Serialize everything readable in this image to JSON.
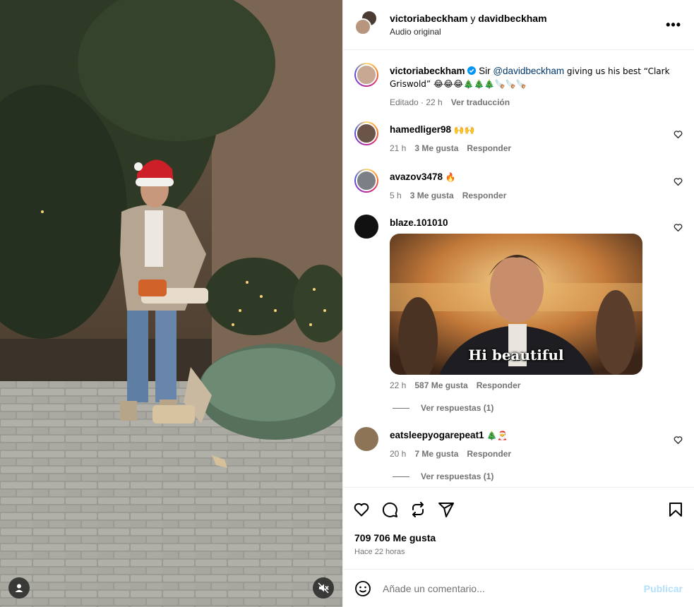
{
  "header": {
    "user1": "victoriabeckham",
    "conjunction": "y",
    "user2": "davidbeckham",
    "audio": "Audio original",
    "more_icon": "more-horizontal-icon"
  },
  "caption": {
    "username": "victoriabeckham",
    "verified": true,
    "text_before": "Sir ",
    "mention": "@davidbeckham",
    "text_after": " giving us his best “Clark Griswold” 😂😂😂🎄🎄🎄🪚🪚🪚",
    "edited": "Editado · 22 h",
    "translate": "Ver traducción"
  },
  "comments": [
    {
      "username": "hamedliger98",
      "text": "🙌🙌",
      "time": "21 h",
      "likes": "3 Me gusta",
      "reply": "Responder"
    },
    {
      "username": "avazov3478",
      "text": "🔥",
      "time": "5 h",
      "likes": "3 Me gusta",
      "reply": "Responder"
    },
    {
      "username": "blaze.101010",
      "text": "",
      "gif_text": "Hi beautiful",
      "time": "22 h",
      "likes": "587 Me gusta",
      "reply": "Responder",
      "view_replies": "Ver respuestas (1)"
    },
    {
      "username": "eatsleepyogarepeat1",
      "text": "🎄🎅",
      "time": "20 h",
      "likes": "7 Me gusta",
      "reply": "Responder",
      "view_replies": "Ver respuestas (1)"
    }
  ],
  "actions": {
    "icons": [
      "heart-icon",
      "comment-icon",
      "share-icon",
      "send-icon",
      "bookmark-icon"
    ],
    "likes": "709 706 Me gusta",
    "ago": "Hace 22 horas"
  },
  "composer": {
    "placeholder": "Añade un comentario...",
    "publish": "Publicar"
  },
  "colors": {
    "link": "#00376b",
    "meta": "#737373",
    "publish": "#b2dffc",
    "verified": "#0095f6"
  }
}
